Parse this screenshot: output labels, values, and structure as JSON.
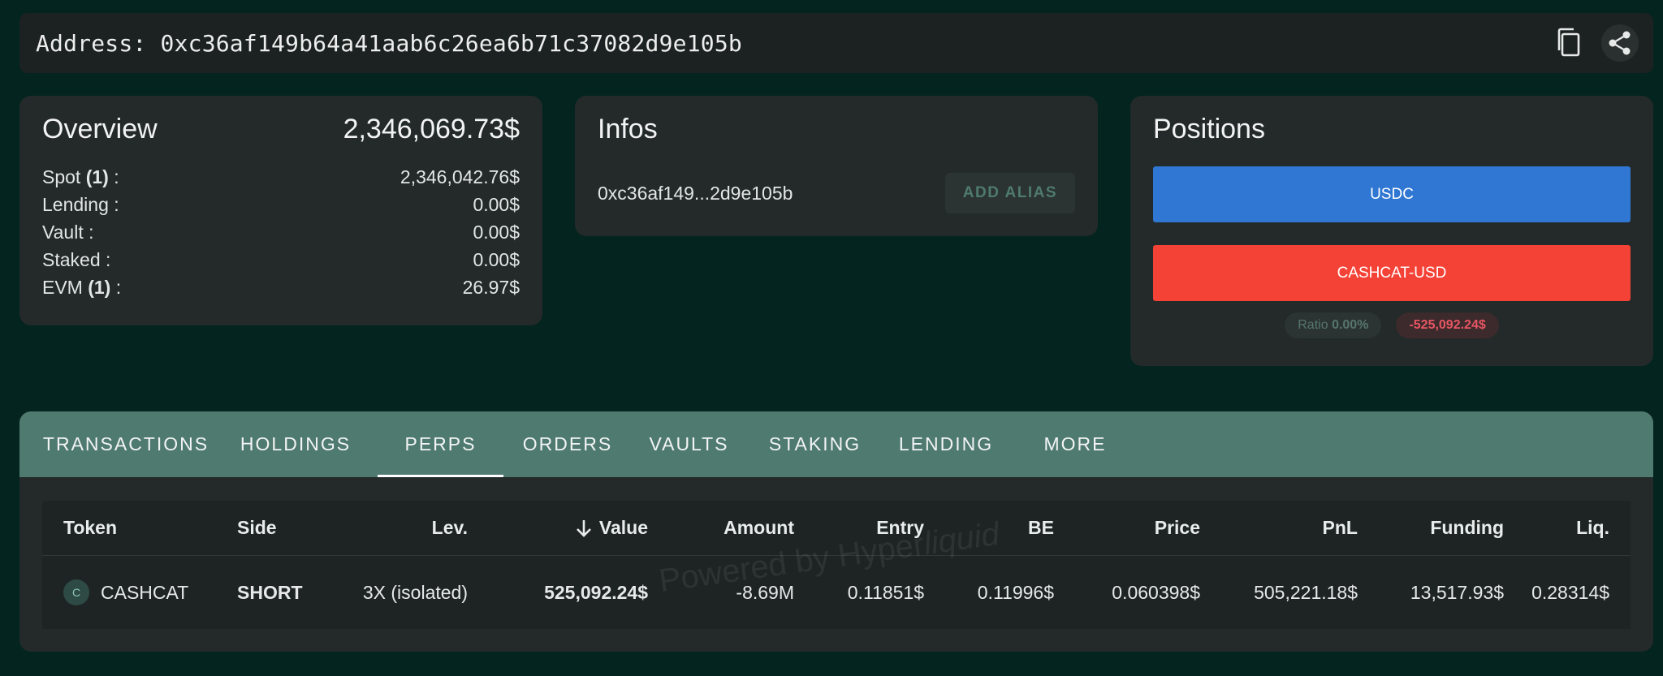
{
  "address": {
    "label": "Address:",
    "value": "0xc36af149b64a41aab6c26ea6b71c37082d9e105b",
    "full": "Address: 0xc36af149b64a41aab6c26ea6b71c37082d9e105b"
  },
  "icons": {
    "copy": "copy-icon",
    "share": "share-icon"
  },
  "overview": {
    "title": "Overview",
    "total": "2,346,069.73$",
    "rows": [
      {
        "label": "Spot",
        "count": "(1)",
        "suffix": " :",
        "value": "2,346,042.76$"
      },
      {
        "label": "Lending :",
        "value": "0.00$"
      },
      {
        "label": "Vault :",
        "value": "0.00$"
      },
      {
        "label": "Staked :",
        "value": "0.00$"
      },
      {
        "label": "EVM",
        "count": "(1)",
        "suffix": " :",
        "value": "26.97$"
      }
    ]
  },
  "infos": {
    "title": "Infos",
    "short_address": "0xc36af149...2d9e105b",
    "alias_button": "ADD ALIAS"
  },
  "positions": {
    "title": "Positions",
    "bars": [
      "USDC",
      "CASHCAT-USD"
    ],
    "ratio_label": "Ratio",
    "ratio_value": "0.00%",
    "pnl_badge": "-525,092.24$"
  },
  "tabs": [
    {
      "label": "TRANSACTIONS"
    },
    {
      "label": "HOLDINGS"
    },
    {
      "label": "PERPS",
      "active": true
    },
    {
      "label": "ORDERS"
    },
    {
      "label": "VAULTS"
    },
    {
      "label": "STAKING"
    },
    {
      "label": "LENDING"
    },
    {
      "label": "MORE"
    }
  ],
  "table": {
    "headers": [
      "Token",
      "Side",
      "Lev.",
      "Value",
      "Amount",
      "Entry",
      "BE",
      "Price",
      "PnL",
      "Funding",
      "Liq."
    ],
    "sort_icon": "arrow-down-icon",
    "rows": [
      {
        "token_letter": "C",
        "token": "CASHCAT",
        "side": "SHORT",
        "lev": "3X (isolated)",
        "value": "525,092.24$",
        "amount": "-8.69M",
        "entry": "0.11851$",
        "be": "0.11996$",
        "price": "0.060398$",
        "pnl": "505,221.18$",
        "funding": "13,517.93$",
        "liq": "0.28314$"
      }
    ]
  },
  "watermark": {
    "text": "Powered by Hyper",
    "italic": "liquid"
  },
  "colors": {
    "background": "#04241f",
    "tab_bar": "#4f7a70",
    "usdc": "#2f77d2",
    "short": "#f44336",
    "pnl_positive": "#2d8a2f"
  }
}
